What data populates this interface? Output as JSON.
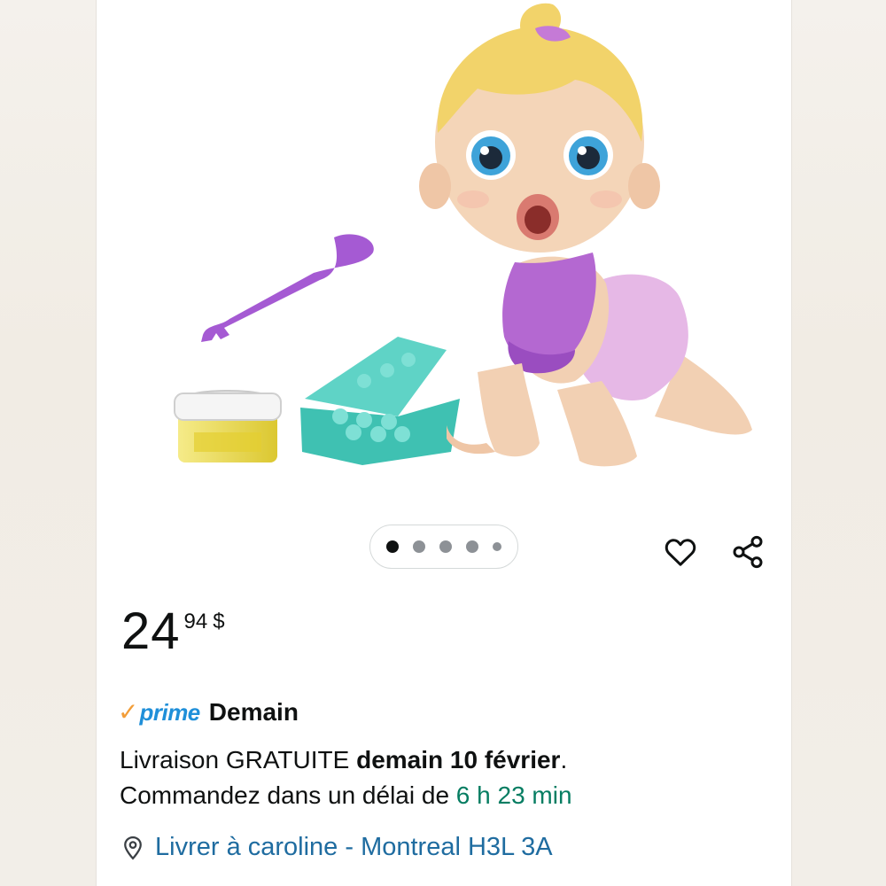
{
  "product": {
    "image_alt": "Baby Alive Lil Snacks blonde doll with spoon, food container and tray"
  },
  "carousel": {
    "dot_count": 5,
    "active_index": 0
  },
  "actions": {
    "wishlist_icon": "heart-outline-icon",
    "share_icon": "share-icon"
  },
  "price": {
    "whole": "24",
    "fraction": "94",
    "currency": "$"
  },
  "delivery": {
    "prime_check": "✓",
    "prime_label": "prime",
    "prime_day": "Demain",
    "line1_prefix": "Livraison GRATUITE ",
    "line1_bold": "demain 10 février",
    "line1_suffix": ".",
    "line2_prefix": "Commandez dans un délai de ",
    "countdown": "6 h 23 min"
  },
  "location": {
    "icon": "location-pin-icon",
    "text": "Livrer à caroline - Montreal H3L 3A"
  },
  "colors": {
    "prime_blue": "#1f8fd9",
    "prime_orange": "#f29d38",
    "countdown_green": "#067d62",
    "link_blue": "#1f6ca0"
  }
}
